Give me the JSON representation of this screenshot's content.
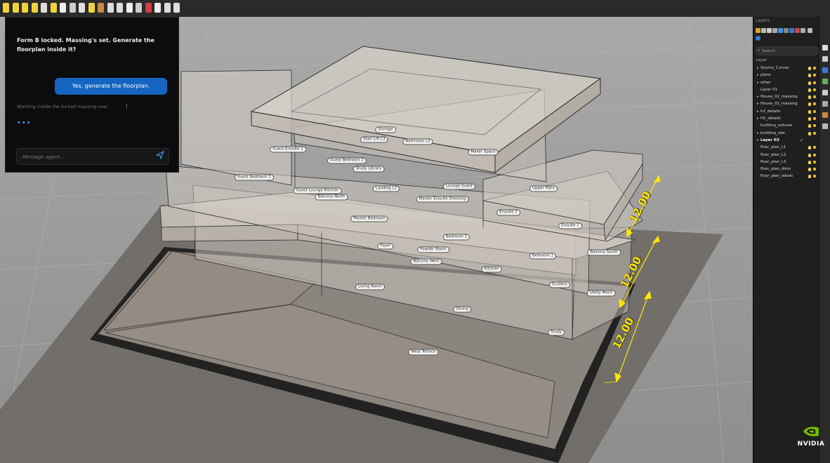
{
  "chat": {
    "prompt": "Form B locked. Massing's set. Generate the floorplan inside it?",
    "user_reply": "Yes, generate the floorplan.",
    "status": "Working inside the locked massing now",
    "typing_indicator": "•••",
    "input_placeholder": "Message agent...",
    "accent_color": "#1565c0"
  },
  "layers_panel": {
    "title": "Layers",
    "search_placeholder": "Search",
    "column_header": "Layer",
    "layers": [
      {
        "name": "Source_Curves",
        "expandable": true,
        "indent": 0
      },
      {
        "name": "plans",
        "expandable": true,
        "indent": 0
      },
      {
        "name": "other",
        "expandable": true,
        "indent": 0
      },
      {
        "name": "Layer 01",
        "expandable": false,
        "indent": 1
      },
      {
        "name": "House_02_massing",
        "expandable": true,
        "indent": 0
      },
      {
        "name": "House_01_massing",
        "expandable": true,
        "indent": 0
      },
      {
        "name": "h2_details",
        "expandable": true,
        "indent": 0
      },
      {
        "name": "H1_details",
        "expandable": true,
        "indent": 0
      },
      {
        "name": "building_volume",
        "expandable": false,
        "indent": 1
      },
      {
        "name": "building_site",
        "expandable": true,
        "indent": 0
      },
      {
        "name": "Layer 03",
        "expandable": true,
        "indent": 0,
        "current": true
      },
      {
        "name": "floor_plan_L1",
        "expandable": false,
        "indent": 1
      },
      {
        "name": "floor_plan_L2",
        "expandable": false,
        "indent": 1
      },
      {
        "name": "floor_plan_L3",
        "expandable": false,
        "indent": 1
      },
      {
        "name": "floor_plan_dims",
        "expandable": false,
        "indent": 1
      },
      {
        "name": "floor_plan_labels",
        "expandable": false,
        "indent": 1
      }
    ]
  },
  "viewport": {
    "room_labels": [
      "Storage",
      "Stair Lift L3",
      "Bathroom L3",
      "Maker Space",
      "Guest Ensuite 1",
      "Guest Bedroom 2",
      "Study Library",
      "Guest Bedroom 1",
      "Landing L2",
      "Lounge Guest",
      "Upper Patio",
      "Guest Lounge Kitchen",
      "Balcony North",
      "Master Ensuite Dressing",
      "Ensuite 2",
      "Ensuite 1",
      "Master Bedroom",
      "Bedroom 2",
      "Foyer",
      "Powder Room",
      "Balcony South",
      "Balcony West",
      "Bedroom 1",
      "Kitchen",
      "Scullery",
      "Utility Mech",
      "Living Room",
      "Dining",
      "Study",
      "West Terrace"
    ],
    "dimensions": [
      "12.00",
      "12.00",
      "12.00"
    ],
    "dimension_color": "#ffe800"
  },
  "branding": {
    "logo_text": "NVIDIA",
    "logo_color": "#76b900"
  }
}
